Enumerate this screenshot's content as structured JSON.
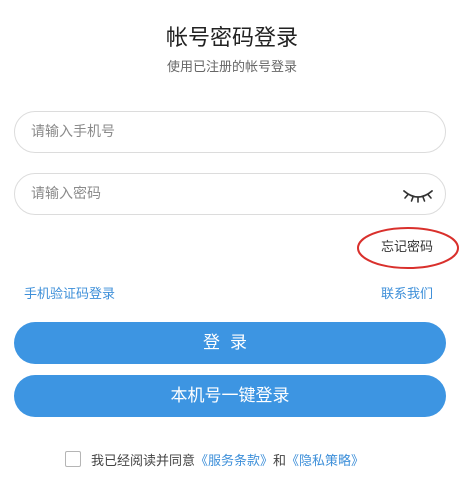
{
  "header": {
    "title": "帐号密码登录",
    "subtitle": "使用已注册的帐号登录"
  },
  "form": {
    "phone": {
      "placeholder": "请输入手机号",
      "value": ""
    },
    "password": {
      "placeholder": "请输入密码",
      "value": "",
      "visibility_icon": "eye-closed-icon"
    },
    "forgot_password": "忘记密码"
  },
  "links": {
    "sms_login": "手机验证码登录",
    "contact_us": "联系我们"
  },
  "buttons": {
    "login": "登录",
    "one_key_login": "本机号一键登录"
  },
  "agreement": {
    "checked": false,
    "text_prefix": "我已经阅读并同意",
    "service_terms": "《服务条款》",
    "conjunction": "和",
    "privacy_policy": "《隐私策略》"
  },
  "colors": {
    "accent": "#3d95e2",
    "link": "#3d8fd9",
    "highlight_ellipse": "#d9302c"
  }
}
